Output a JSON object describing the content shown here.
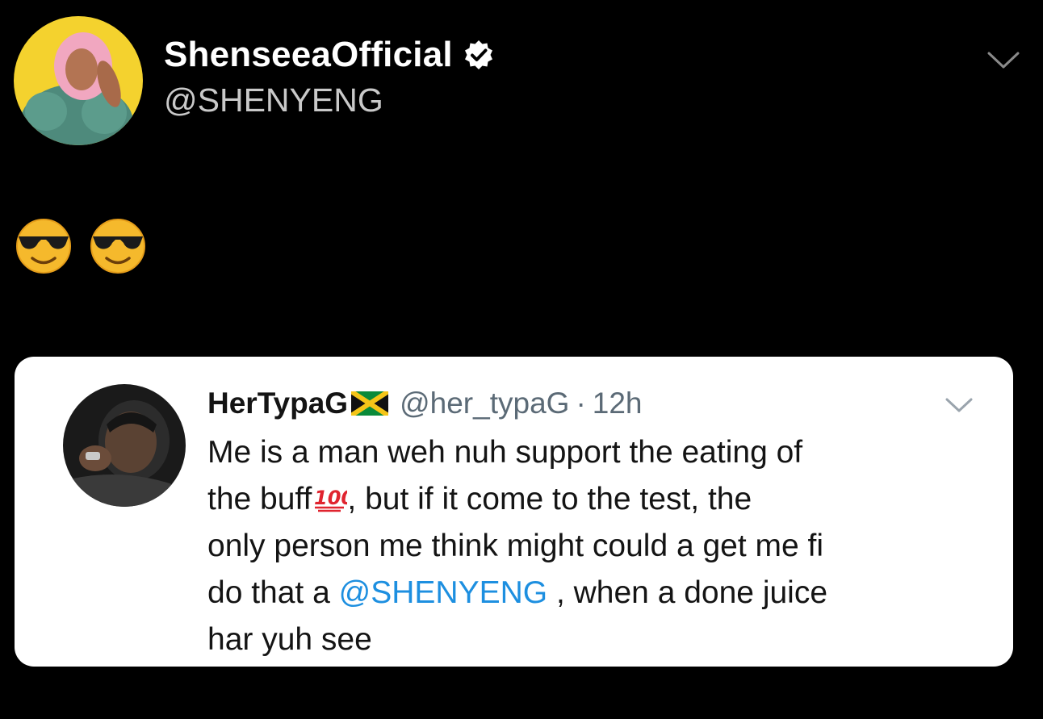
{
  "tweet": {
    "display_name": "ShenseeaOfficial",
    "handle": "@SHENYENG",
    "verified_icon": "verified-badge-icon",
    "body_emojis": [
      "smiling-face-with-sunglasses",
      "smiling-face-with-sunglasses"
    ],
    "menu_icon": "chevron-down-icon"
  },
  "quoted_tweet": {
    "display_name": "HerTypaG",
    "flag_icon": "jamaica-flag-icon",
    "handle": "@her_typaG",
    "separator": "·",
    "time": "12h",
    "menu_icon": "chevron-down-icon",
    "text": {
      "line1": "Me is a man weh nuh support the eating of",
      "line2_a": "the buff",
      "line2_b": ",  but if it come to the test, the",
      "line3": "only person me think might could a get me fi",
      "line4_a": "do that a ",
      "line4_mention": "@SHENYENG",
      "line4_b": " , when a done juice",
      "line5": "har yuh see"
    },
    "inline_emoji": "hundred-points-icon"
  },
  "colors": {
    "background": "#000000",
    "card": "#ffffff",
    "mention": "#1d8fe0",
    "secondary_text": "#5b6a76",
    "verified_badge": "#ffffff",
    "avatar_ring": "#f4d22e"
  }
}
